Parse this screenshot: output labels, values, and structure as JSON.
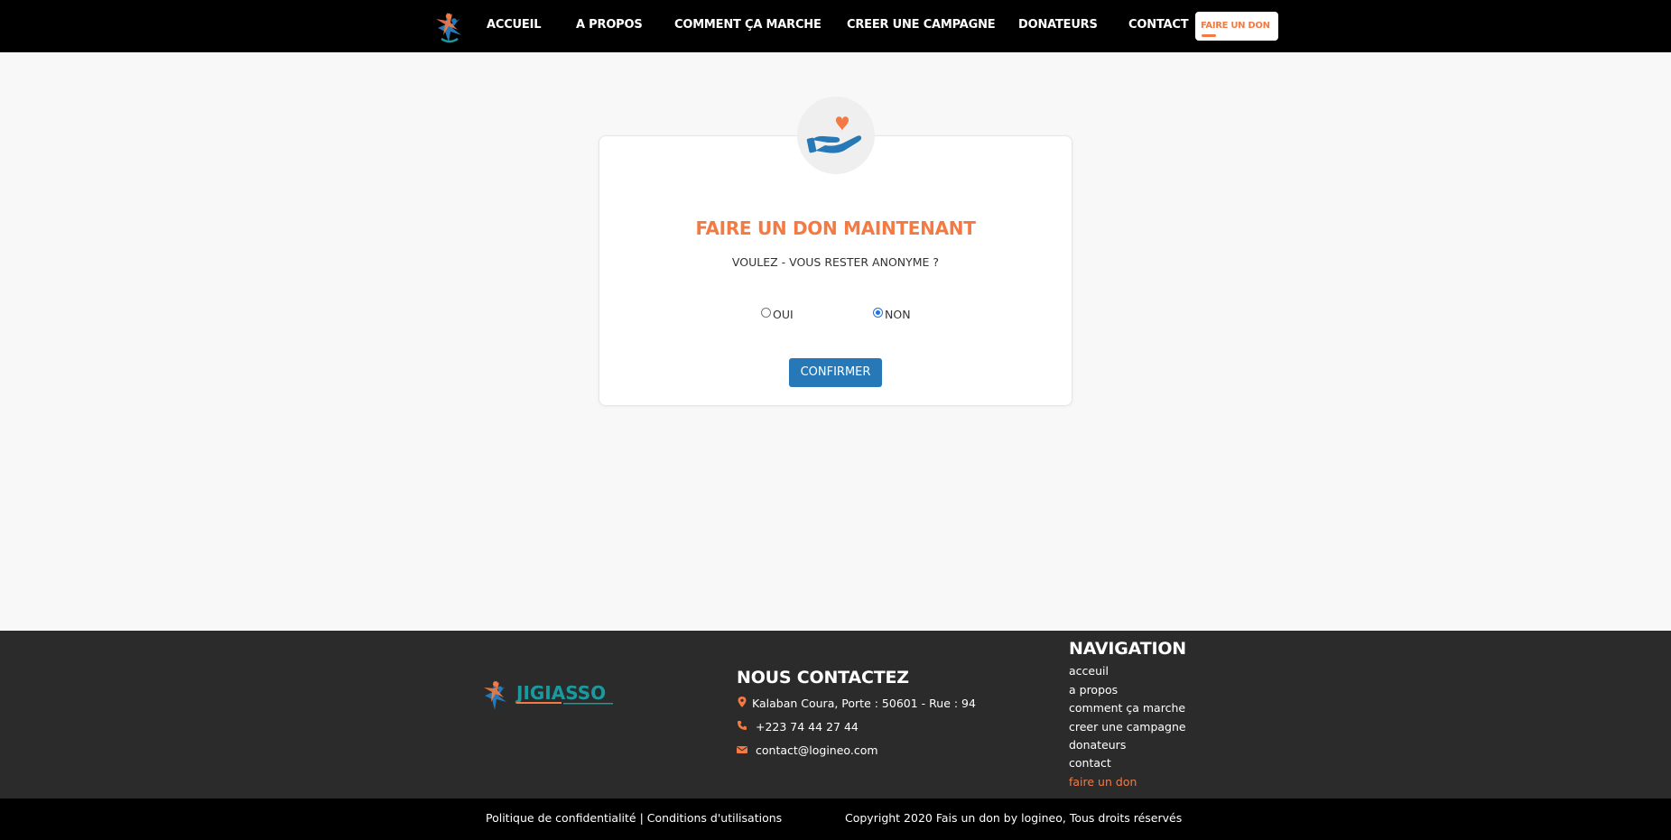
{
  "nav": {
    "items": [
      "ACCUEIL",
      "A PROPOS",
      "COMMENT ÇA MARCHE",
      "CREER UNE CAMPAGNE",
      "DONATEURS",
      "CONTACT"
    ],
    "cta": "FAIRE UN DON"
  },
  "card": {
    "title": "FAIRE UN DON MAINTENANT",
    "question": "VOULEZ - VOUS RESTER ANONYME ?",
    "options": [
      {
        "label": "OUI",
        "checked": false
      },
      {
        "label": "NON",
        "checked": true
      }
    ],
    "confirm": "CONFIRMER"
  },
  "footer": {
    "logo_text": "JIGIASSO",
    "contact_heading": "NOUS CONTACTEZ",
    "address": "Kalaban Coura, Porte : 50601 - Rue : 94",
    "phone": "+223 74 44 27 44",
    "email": "contact@logineo.com",
    "nav_heading": "NAVIGATION",
    "nav_items": [
      "acceuil",
      "a propos",
      "comment ça marche",
      "creer une campagne",
      "donateurs",
      "contact",
      "faire un don"
    ]
  },
  "bottom": {
    "policy": "Politique de confidentialité | Conditions d'utilisations",
    "copyright": "Copyright 2020 Fais un don by logineo, Tous droits réservés"
  },
  "colors": {
    "accent_orange": "#f47a44",
    "accent_blue": "#2678b7",
    "teal": "#1a9a9e",
    "nav_bg": "#000000",
    "footer_bg": "#2b2b2b"
  }
}
